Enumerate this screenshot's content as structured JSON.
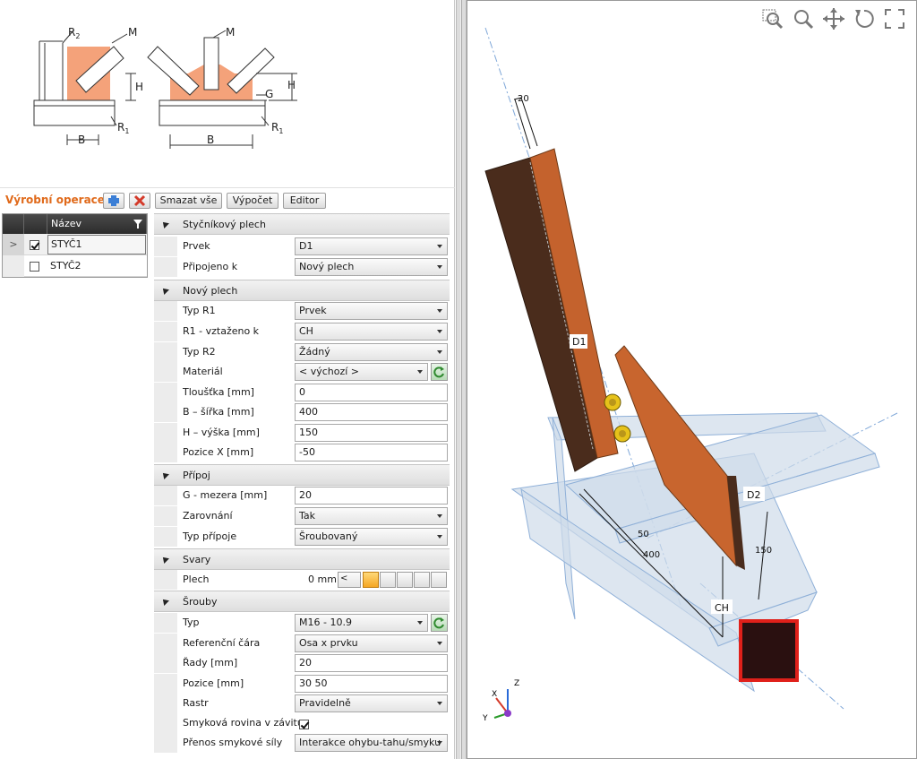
{
  "toolbar": {
    "title": "Výrobní operace",
    "add_icon": "plus-icon",
    "delete_icon": "delete-x-icon",
    "clear_all": "Smazat vše",
    "calculate": "Výpočet",
    "editor": "Editor"
  },
  "sketch": {
    "left": {
      "r2": "R",
      "r2_sub": "2",
      "m": "M",
      "h": "H",
      "r1": "R",
      "r1_sub": "1",
      "b": "B"
    },
    "right": {
      "m": "M",
      "h": "H",
      "g": "G",
      "r1": "R",
      "r1_sub": "1",
      "b": "B"
    },
    "colors": {
      "plate": "#f4a27a",
      "line": "#333333"
    }
  },
  "list": {
    "header": "Název",
    "rows": [
      {
        "name": "STYČ1",
        "checked": true,
        "selected": true
      },
      {
        "name": "STYČ2",
        "checked": false,
        "selected": false
      }
    ]
  },
  "props": {
    "g1": {
      "title": "Styčníkový plech",
      "prvek_label": "Prvek",
      "prvek_value": "D1",
      "pripojeno_label": "Připojeno k",
      "pripojeno_value": "Nový plech"
    },
    "g2": {
      "title": "Nový plech",
      "typr1_label": "Typ R1",
      "typr1_value": "Prvek",
      "r1v_label": "R1 - vztaženo k",
      "r1v_value": "CH",
      "typr2_label": "Typ R2",
      "typr2_value": "Žádný",
      "mat_label": "Materiál",
      "mat_value": "< výchozí >",
      "t_label": "Tloušťka [mm]",
      "t_value": "0",
      "b_label": "B – šířka [mm]",
      "b_value": "400",
      "h_label": "H – výška [mm]",
      "h_value": "150",
      "px_label": "Pozice X [mm]",
      "px_value": "-50"
    },
    "g3": {
      "title": "Přípoj",
      "g_label": "G - mezera [mm]",
      "g_value": "20",
      "zar_label": "Zarovnání",
      "zar_value": "Tak",
      "typp_label": "Typ přípoje",
      "typp_value": "Šroubovaný"
    },
    "g4": {
      "title": "Svary",
      "plech_label": "Plech",
      "plech_value": "0 mm",
      "weld_dd": "<"
    },
    "g5": {
      "title": "Šrouby",
      "typ_label": "Typ",
      "typ_value": "M16 - 10.9",
      "ref_label": "Referenční čára",
      "ref_value": "Osa x prvku",
      "rady_label": "Řady [mm]",
      "rady_value": "20",
      "poz_label": "Pozice [mm]",
      "poz_value": "30 50",
      "rastr_label": "Rastr",
      "rastr_value": "Pravidelně",
      "smyk_label": "Smyková rovina v závitu",
      "smyk_checked": true,
      "prenos_label": "Přenos smykové síly",
      "prenos_value": "Interakce ohybu-tahu/smyku"
    }
  },
  "viewport": {
    "tools": [
      "zoom-window-icon",
      "zoom-icon",
      "pan-icon",
      "rotate-icon",
      "fit-icon"
    ],
    "labels": {
      "d1": "D1",
      "d2": "D2",
      "ch": "CH",
      "dim20": "20",
      "dim50": "50",
      "dim400": "400",
      "dim150": "150"
    },
    "axes": {
      "x": "X",
      "y": "Y",
      "z": "Z"
    },
    "colors": {
      "member_dark": "#4a2c1c",
      "member": "#c4622d",
      "plate": "#c8652e",
      "chord": "#c9d6e6",
      "section_fill": "#2a1010",
      "section_edge": "#e0201a",
      "bolt": "#e6c21a"
    }
  }
}
